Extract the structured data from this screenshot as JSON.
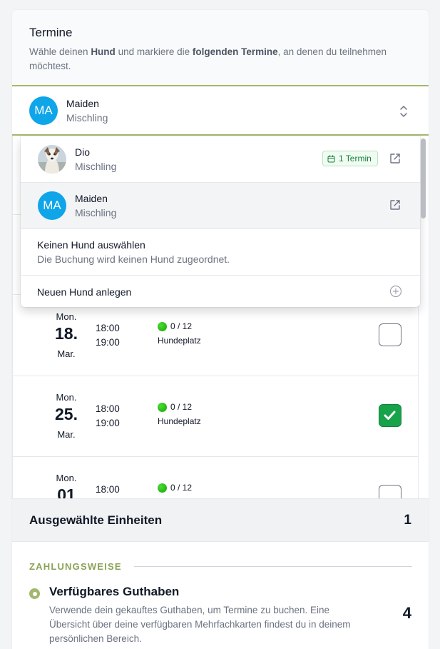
{
  "header": {
    "title": "Termine",
    "sub_1": "Wähle deinen ",
    "sub_b1": "Hund",
    "sub_2": " und markiere die ",
    "sub_b2": "folgenden Termine",
    "sub_3": ", an denen du teilnehmen möchtest."
  },
  "selected_dog": {
    "initials": "MA",
    "name": "Maiden",
    "breed": "Mischling"
  },
  "dropdown": {
    "options": [
      {
        "name": "Dio",
        "breed": "Mischling",
        "badge": "1 Termin"
      },
      {
        "initials": "MA",
        "name": "Maiden",
        "breed": "Mischling"
      }
    ],
    "no_dog": {
      "title": "Keinen Hund auswählen",
      "desc": "Die Buchung wird keinen Hund zugeordnet."
    },
    "new_dog": "Neuen Hund anlegen"
  },
  "appointments": [
    {
      "weekday": "Mon.",
      "day": "18.",
      "month": "Mar.",
      "start": "18:00",
      "end": "19:00",
      "capacity": "0 / 12",
      "location": "Hundeplatz",
      "checked": false
    },
    {
      "weekday": "Mon.",
      "day": "25.",
      "month": "Mar.",
      "start": "18:00",
      "end": "19:00",
      "capacity": "0 / 12",
      "location": "Hundeplatz",
      "checked": true
    },
    {
      "weekday": "Mon.",
      "day": "01",
      "month": "",
      "start": "18:00",
      "end": "",
      "capacity": "0 / 12",
      "location": "",
      "checked": false
    }
  ],
  "summary": {
    "label": "Ausgewählte Einheiten",
    "count": "1"
  },
  "payment": {
    "heading": "ZAHLUNGSWEISE",
    "title": "Verfügbares Guthaben",
    "desc": "Verwende dein gekauftes Guthaben, um Termine zu buchen. Eine Übersicht über deine verfügbaren Mehrfachkarten findest du in deinem persönlichen Bereich.",
    "value": "4"
  },
  "colors": {
    "accent": "#a3b86c",
    "avatar": "#0ea5e9",
    "check": "#16a34a",
    "status_dot": "#22c55e"
  }
}
